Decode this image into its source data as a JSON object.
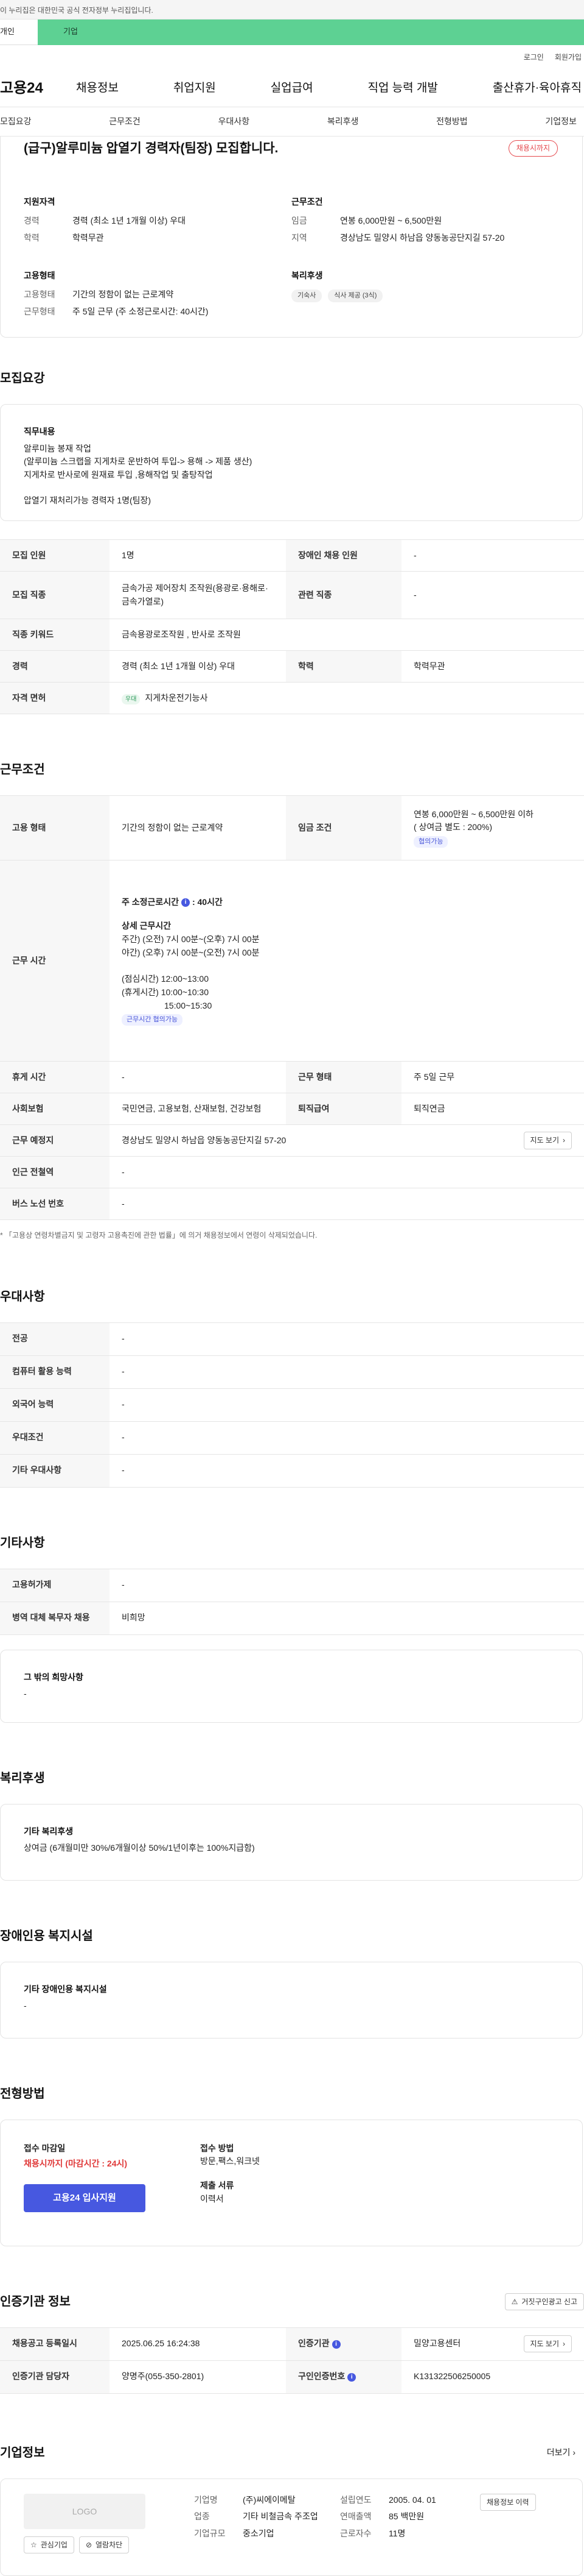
{
  "gov_bar": "이 누리집은 대한민국 공식 전자정부 누리집입니다.",
  "top_tabs": [
    "개인",
    "기업"
  ],
  "util_links": [
    "로그인",
    "회원가입"
  ],
  "logo": "고용24",
  "gnb": [
    "채용정보",
    "취업지원",
    "실업급여",
    "직업 능력 개발",
    "출산휴가·육아휴직"
  ],
  "anchor_nav": [
    "모집요강",
    "근무조건",
    "우대사항",
    "복리후생",
    "전형방법",
    "기업정보"
  ],
  "summary": {
    "title": "(급구)알루미늄 압열기 경력자(팀장) 모집합니다.",
    "status_badge": "채용시까지",
    "qual_title": "지원자격",
    "career_k": "경력",
    "career_v": "경력 (최소 1년 1개월 이상) 우대",
    "edu_k": "학력",
    "edu_v": "학력무관",
    "cond_title": "근무조건",
    "wage_k": "임금",
    "wage_v": "연봉 6,000만원 ~ 6,500만원",
    "region_k": "지역",
    "region_v": "경상남도 밀양시 하남읍 양동농공단지길 57-20",
    "emp_title": "고용형태",
    "emptype_k": "고용형태",
    "emptype_v": "기간의 정함이 없는 근로계약",
    "workform_k": "근무형태",
    "workform_v": "주 5일 근무 (주 소정근로시간: 40시간)",
    "welfare_title": "복리후생",
    "welfare_pills": [
      "기숙사",
      "식사 제공 (3식)"
    ]
  },
  "recruit": {
    "title": "모집요강",
    "duty_title": "직무내용",
    "duty_lines": [
      "알루미늄 봉재 작업",
      "(알루미늄 스크랩을 지게차로 운반하여 투입-> 용해 -> 제품 생산)",
      "지게차로 반사로에 원재료 투입 ,용해작업 및 출탕작업",
      "",
      "압열기 재처리가능 경력자 1명(팀장)"
    ],
    "rows": {
      "headcount_k": "모집 인원",
      "headcount_v": "1명",
      "disabled_k": "장애인 채용 인원",
      "disabled_v": "-",
      "occupation_k": "모집 직종",
      "occupation_v": "금속가공 제어장치 조작원(용광로·용해로·금속가열로)",
      "related_k": "관련 직종",
      "related_v": "-",
      "keyword_k": "직종 키워드",
      "keyword_v": "금속용광로조작원 , 반사로 조작원",
      "career_k": "경력",
      "career_v": "경력 (최소 1년 1개월 이상) 우대",
      "edu_k": "학력",
      "edu_v": "학력무관",
      "license_k": "자격 면허",
      "license_pill": "우대",
      "license_v": "지게차운전기능사"
    }
  },
  "work": {
    "title": "근무조건",
    "emptype_k": "고용 형태",
    "emptype_v": "기간의 정함이 없는 근로계약",
    "wage_k": "임금 조건",
    "wage_v1": "연봉 6,000만원 ~ 6,500만원 이하",
    "wage_v2": "( 상여금 별도 : 200%)",
    "wage_pill": "협의가능",
    "hours_k": "근무 시간",
    "hours_main": "주 소정근로시간",
    "hours_main_v": ": 40시간",
    "hours_detail_title": "상세 근무시간",
    "hours_lines": [
      "주간) (오전) 7시 00분~(오후) 7시 00분",
      "야간) (오후) 7시 00분~(오전) 7시 00분",
      "",
      "(점심시간) 12:00~13:00",
      "(휴게시간) 10:00~10:30",
      "                  15:00~15:30"
    ],
    "hours_pill": "근무시간 협의가능",
    "rest_k": "휴게 시간",
    "rest_v": "-",
    "workform_k": "근무 형태",
    "workform_v": "주 5일 근무",
    "insurance_k": "사회보험",
    "insurance_v": "국민연금, 고용보험, 산재보험, 건강보험",
    "severance_k": "퇴직급여",
    "severance_v": "퇴직연금",
    "place_k": "근무 예정지",
    "place_v": "경상남도 밀양시 하남읍 양동농공단지길 57-20",
    "map_btn": "지도 보기",
    "subway_k": "인근 전철역",
    "subway_v": "-",
    "bus_k": "버스 노선 번호",
    "bus_v": "-",
    "note": "* 「고용상 연령차별금지 및 고령자 고용촉진에 관한 법률」에 의거 채용정보에서 연령이 삭제되었습니다."
  },
  "prefer": {
    "title": "우대사항",
    "rows": [
      {
        "k": "전공",
        "v": "-"
      },
      {
        "k": "컴퓨터 활용 능력",
        "v": "-"
      },
      {
        "k": "외국어 능력",
        "v": "-"
      },
      {
        "k": "우대조건",
        "v": "-"
      },
      {
        "k": "기타 우대사항",
        "v": "-"
      }
    ]
  },
  "etc": {
    "title": "기타사항",
    "rows": [
      {
        "k": "고용허가제",
        "v": "-"
      },
      {
        "k": "병역 대체 복무자 채용",
        "v": "비희망"
      }
    ],
    "hope_title": "그 밖의 희망사항",
    "hope_v": "-"
  },
  "welfare": {
    "title": "복리후생",
    "box_title": "기타 복리후생",
    "box_v": "상여금 (6개월미만 30%/6개월이상 50%/1년이후는 100%지급함)"
  },
  "disabled_fac": {
    "title": "장애인용 복지시설",
    "box_title": "기타 장애인용 복지시설",
    "box_v": "-"
  },
  "screening": {
    "title": "전형방법",
    "deadline_k": "접수 마감일",
    "deadline_v": "채용시까지 (마감시간 : 24시)",
    "apply_btn": "고용24 입사지원",
    "method_k": "접수 방법",
    "method_v": "방문,팩스,워크넷",
    "docs_k": "제출 서류",
    "docs_v": "이력서"
  },
  "auth": {
    "title": "인증기관 정보",
    "report_btn": "거짓구인광고 신고",
    "reg_k": "채용공고 등록일시",
    "reg_v": "2025.06.25 16:24:38",
    "org_k": "인증기관",
    "org_v": "밀양고용센터",
    "map_btn": "지도 보기",
    "staff_k": "인증기관 담당자",
    "staff_v": "양명주(055-350-2801)",
    "num_k": "구인인증번호",
    "num_v": "K131322506250005"
  },
  "company": {
    "title": "기업정보",
    "more": "더보기",
    "logo_text": "LOGO",
    "fav_btn": "관심기업",
    "block_btn": "열람차단",
    "name_k": "기업명",
    "name_v": "(주)씨에이메탈",
    "industry_k": "업종",
    "industry_v": "기타 비철금속 주조업",
    "size_k": "기업규모",
    "size_v": "중소기업",
    "year_k": "설립연도",
    "year_v": "2005. 04. 01",
    "revenue_k": "연매출액",
    "revenue_v": "85 백만원",
    "employees_k": "근로자수",
    "employees_v": "11명",
    "jobs_btn": "채용정보 이력"
  },
  "colors": {
    "accent": "#4758e0",
    "brand_green": "#5dd193",
    "alert": "#e5484d"
  }
}
